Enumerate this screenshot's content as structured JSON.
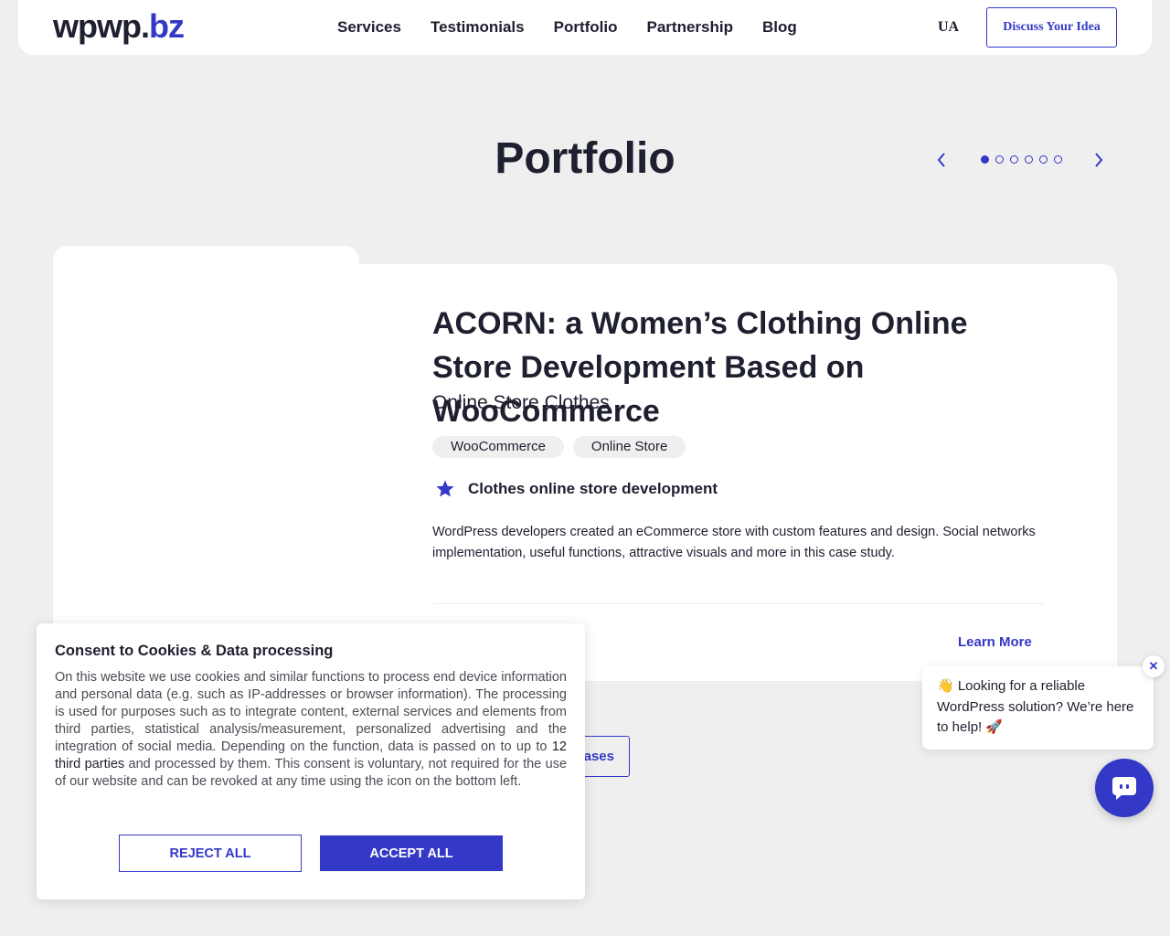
{
  "header": {
    "logo_main": "wpwp.",
    "logo_accent": "bz",
    "nav": [
      "Services",
      "Testimonials",
      "Portfolio",
      "Partnership",
      "Blog"
    ],
    "lang": "UA",
    "cta_label": "Discuss Your Idea"
  },
  "portfolio": {
    "title": "Portfolio",
    "slide_count": 6,
    "active_slide": 1
  },
  "case": {
    "title": "ACORN: a Women’s Clothing Online Store Development Based on WooCommerce",
    "subtitle": "Online Store Clothes",
    "tags": [
      "WooCommerce",
      "Online Store"
    ],
    "feature": "Clothes online store development",
    "description": "WordPress developers created an eCommerce store with custom features and design. Social networks implementation, useful functions, attractive visuals and more in this case study.",
    "learn_more": "Learn More"
  },
  "all_cases_label": "ases",
  "cookie": {
    "title": "Consent to Cookies & Data processing",
    "text_before": "On this website we use cookies and similar functions to process end device information and personal data (e.g. such as IP-addresses or browser information). The processing is used for purposes such as to integrate content, external services and elements from third parties, statistical analysis/measurement, personalized advertising and the integration of social media. Depending on the function, data is passed on to up to ",
    "link_text": "12 third parties",
    "text_after": " and processed by them. This consent is voluntary, not required for the use of our website and can be revoked at any time using the icon on the bottom left.",
    "reject_label": "REJECT ALL",
    "accept_label": "ACCEPT ALL"
  },
  "chat": {
    "message": "👋 Looking for a reliable WordPress solution? We’re here to help! 🚀",
    "close_label": "✕"
  },
  "colors": {
    "accent": "#3338c7",
    "background": "#efefef",
    "text": "#1e1f2f"
  }
}
